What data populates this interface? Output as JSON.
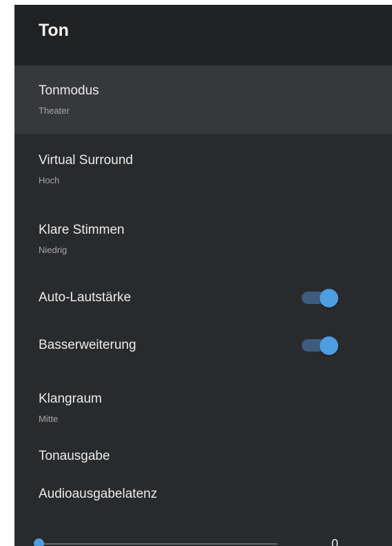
{
  "header": {
    "title": "Ton"
  },
  "items": [
    {
      "title": "Tonmodus",
      "value": "Theater"
    },
    {
      "title": "Virtual Surround",
      "value": "Hoch"
    },
    {
      "title": "Klare Stimmen",
      "value": "Niedrig"
    },
    {
      "title": "Auto-Lautstärke",
      "toggle_on": true
    },
    {
      "title": "Basserweiterung",
      "toggle_on": true
    },
    {
      "title": "Klangraum",
      "value": "Mitte"
    },
    {
      "title": "Tonausgabe"
    },
    {
      "title": "Audioausgabelatenz",
      "slider_value": "0",
      "slider_fraction": 0
    }
  ],
  "colors": {
    "panel_bg": "#292a2c",
    "header_bg": "#202123",
    "selected_bg": "#37383b",
    "accent": "#4d9de0",
    "toggle_track": "#3e5d7e"
  }
}
